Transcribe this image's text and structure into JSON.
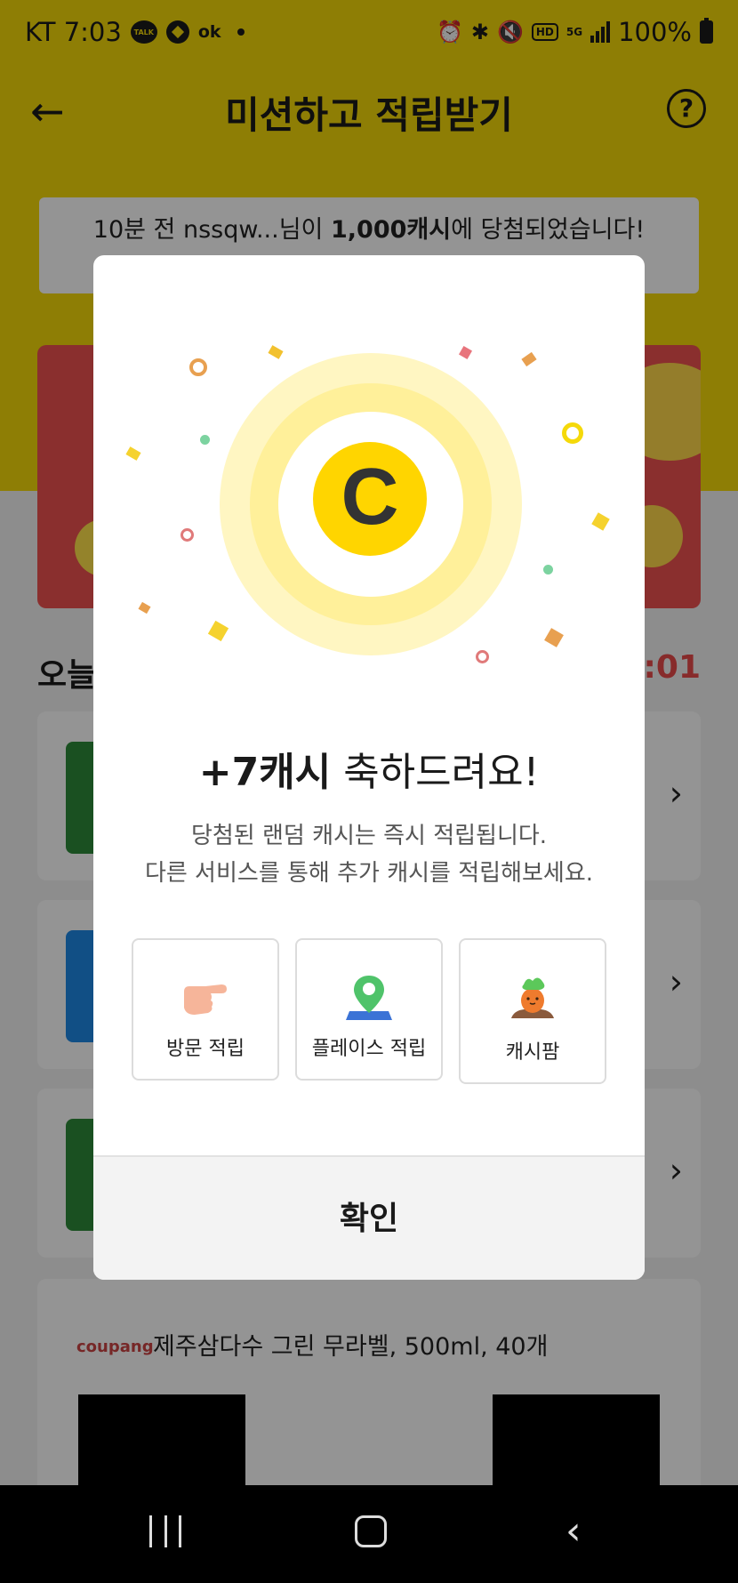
{
  "status_bar": {
    "carrier_time": "KT 7:03",
    "talk_badge": "TALK",
    "ok_badge": "ok",
    "battery": "100%",
    "network": "5G",
    "hd": "HD"
  },
  "header": {
    "title": "미션하고 적립받기",
    "help": "?"
  },
  "ticker": {
    "prefix": "10분 전 nssqw...님이 ",
    "amount": "1,000캐시",
    "suffix": "에 당첨되었습니다!"
  },
  "background": {
    "section_title": "오늘",
    "timer": "3:01",
    "product_brand": "coupang",
    "product_name": "제주삼다수 그린 무라벨, 500ml, 40개"
  },
  "modal": {
    "coin_letter": "C",
    "reward_amount": "+7캐시",
    "reward_message": " 축하드려요!",
    "desc_line1": "당첨된 랜덤 캐시는 즉시 적립됩니다.",
    "desc_line2": "다른 서비스를 통해 추가 캐시를 적립해보세요.",
    "tiles": [
      {
        "label": "방문 적립",
        "icon": "pointing-hand-icon"
      },
      {
        "label": "플레이스 적립",
        "icon": "map-pin-icon"
      },
      {
        "label": "캐시팜",
        "icon": "carrot-icon"
      }
    ],
    "confirm_label": "확인"
  },
  "colors": {
    "brand_yellow": "#f5d90a",
    "coin_yellow": "#ffd500",
    "banner_red": "#ee5150",
    "timer_red": "#e84b4b"
  }
}
